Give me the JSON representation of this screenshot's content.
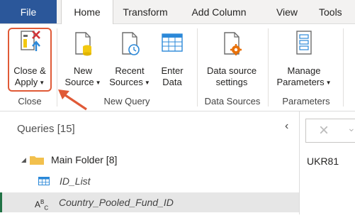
{
  "tabs": {
    "file": "File",
    "home": "Home",
    "transform": "Transform",
    "add_column": "Add Column",
    "view": "View",
    "tools": "Tools"
  },
  "ribbon": {
    "close_apply": {
      "line1": "Close &",
      "line2": "Apply"
    },
    "new_source": {
      "line1": "New",
      "line2": "Source"
    },
    "recent_sources": {
      "line1": "Recent",
      "line2": "Sources"
    },
    "enter_data": {
      "line1": "Enter",
      "line2": "Data"
    },
    "data_source_settings": {
      "line1": "Data source",
      "line2": "settings"
    },
    "manage_parameters": {
      "line1": "Manage",
      "line2": "Parameters"
    },
    "groups": {
      "close": "Close",
      "new_query": "New Query",
      "data_sources": "Data Sources",
      "parameters": "Parameters"
    }
  },
  "queries": {
    "header": "Queries [15]",
    "folder": "Main Folder [8]",
    "items": [
      {
        "label": "ID_List"
      },
      {
        "label": "Country_Pooled_Fund_ID",
        "type_badge": "ABC"
      }
    ]
  },
  "editor": {
    "value": "UKR81"
  },
  "colors": {
    "file_tab": "#2b579a",
    "highlight": "#e05a37",
    "selected_marker": "#217346"
  }
}
